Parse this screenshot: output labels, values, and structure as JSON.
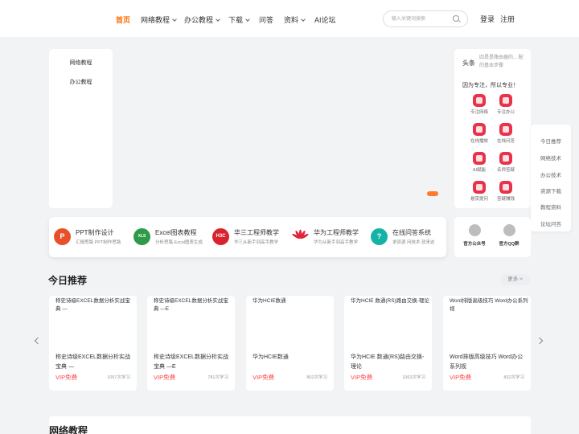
{
  "header": {
    "nav": [
      {
        "label": "首页",
        "dropdown": false
      },
      {
        "label": "网络教程",
        "dropdown": true
      },
      {
        "label": "办公教程",
        "dropdown": true
      },
      {
        "label": "下载",
        "dropdown": true
      },
      {
        "label": "问答",
        "dropdown": false
      },
      {
        "label": "资料",
        "dropdown": true
      },
      {
        "label": "AI论坛",
        "dropdown": false
      }
    ],
    "search_placeholder": "输入关键词搜索",
    "login": "登录",
    "register": "注册"
  },
  "left_menu": [
    "网络教程",
    "办公教程"
  ],
  "right_panel": {
    "headline_label": "头条",
    "headline_text": "四是是路由器的... 配的基本步骤",
    "slogan": "因为专注，所以专业！",
    "services": [
      {
        "label": "专注网络",
        "icon": "network-icon"
      },
      {
        "label": "专注办公",
        "icon": "office-icon"
      },
      {
        "label": "在线播放",
        "icon": "play-icon"
      },
      {
        "label": "在线问答",
        "icon": "qa-icon"
      },
      {
        "label": "AI赋能",
        "icon": "ai-icon"
      },
      {
        "label": "名师答疑",
        "icon": "teacher-icon"
      },
      {
        "label": "悬赏提问",
        "icon": "reward-icon"
      },
      {
        "label": "答疑赚钱",
        "icon": "earn-icon"
      }
    ]
  },
  "side_nav": [
    "今日推荐",
    "网络技术",
    "办公技术",
    "资源下载",
    "教程资料",
    "论坛问答"
  ],
  "features": [
    {
      "title": "PPT制作设计",
      "desc": "汇报思路 PPT制作思路",
      "icon_text": "P",
      "color": "#e8502c"
    },
    {
      "title": "Excel图表教程",
      "desc": "分析思路 Excel图表生成",
      "icon_text": "XLS",
      "color": "#2e9a4a"
    },
    {
      "title": "华三工程师教学",
      "desc": "华三从新手到高手教学",
      "icon_text": "H3C",
      "color": "#d9232e"
    },
    {
      "title": "华为工程师教学",
      "desc": "华为从新手到高手教学",
      "icon_text": "",
      "color": "#e0263a"
    },
    {
      "title": "在线问答系统",
      "desc": "求资源 问技术 就来这",
      "icon_text": "?",
      "color": "#15b3a6"
    }
  ],
  "official": [
    {
      "label": "官方公众号"
    },
    {
      "label": "官方QQ群"
    }
  ],
  "today": {
    "title": "今日推荐",
    "more": "更多 >",
    "cards": [
      {
        "alt": "称史诗级EXCEL数据分析实战宝典 —",
        "title": "称史诗级EXCEL数据分析实战宝典 —",
        "vip": "VIP免费",
        "count": "1057次学习"
      },
      {
        "alt": "称史诗级EXCEL数据分析实战宝典 —E",
        "title": "称史诗级EXCEL数据分析实战宝典 —E",
        "vip": "VIP免费",
        "count": "781次学习"
      },
      {
        "alt": "华为HCIE数通",
        "title": "华为HCIE数通",
        "vip": "VIP免费",
        "count": "802次学习"
      },
      {
        "alt": "华为HCIE 数通(RS)路由交换-理论",
        "title": "华为HCIE 数通(RS)路由交换-理论",
        "vip": "VIP免费",
        "count": "1063次学习"
      },
      {
        "alt": "Word排版高级技巧 Word办公系列视",
        "title": "Word排版高级技巧 Word办公系列视",
        "vip": "VIP免费",
        "count": "832次学习"
      }
    ]
  },
  "network_section": {
    "title": "网络教程"
  },
  "colors": {
    "accent": "#ff6a00",
    "vip": "#ff4040",
    "service": "#e8334a"
  }
}
